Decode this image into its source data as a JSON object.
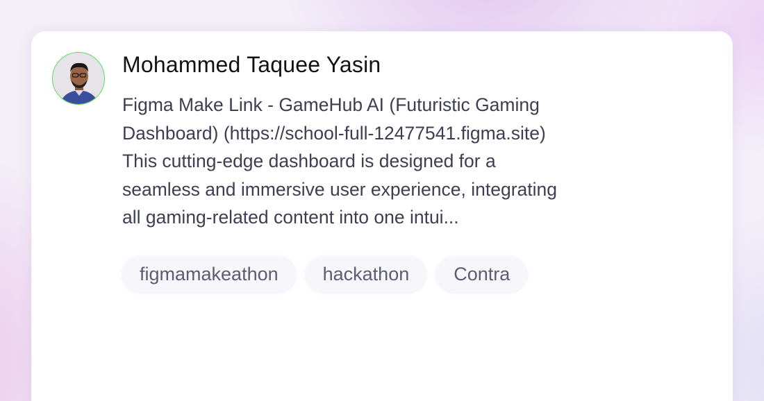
{
  "post": {
    "author": "Mohammed Taquee Yasin",
    "avatar_icon": "profile-photo",
    "avatar_ring_color": "#5cd65c",
    "description_lines": [
      "Figma Make Link - GameHub AI (Futuristic Gaming",
      "Dashboard) (https://school-full-12477541.figma.site)",
      "This cutting-edge dashboard is designed for a",
      "seamless and immersive user experience, integrating",
      "all gaming-related content into one intui..."
    ],
    "tags": [
      "figmamakeathon",
      "hackathon",
      "Contra"
    ]
  }
}
